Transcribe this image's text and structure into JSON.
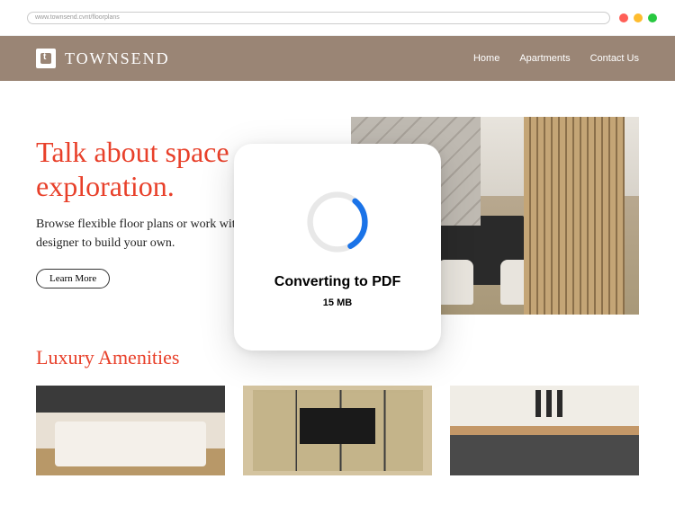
{
  "browser": {
    "url": "www.townsend.cvnt/floorplans"
  },
  "navbar": {
    "brand": "TOWNSEND",
    "links": [
      "Home",
      "Apartments",
      "Contact Us"
    ]
  },
  "hero": {
    "title": "Talk about space exploration.",
    "subtitle": "Browse flexible floor plans or work with a designer to build your own.",
    "cta": "Learn More"
  },
  "amenities": {
    "title": "Luxury Amenities"
  },
  "modal": {
    "title": "Converting to PDF",
    "size": "15 MB"
  }
}
